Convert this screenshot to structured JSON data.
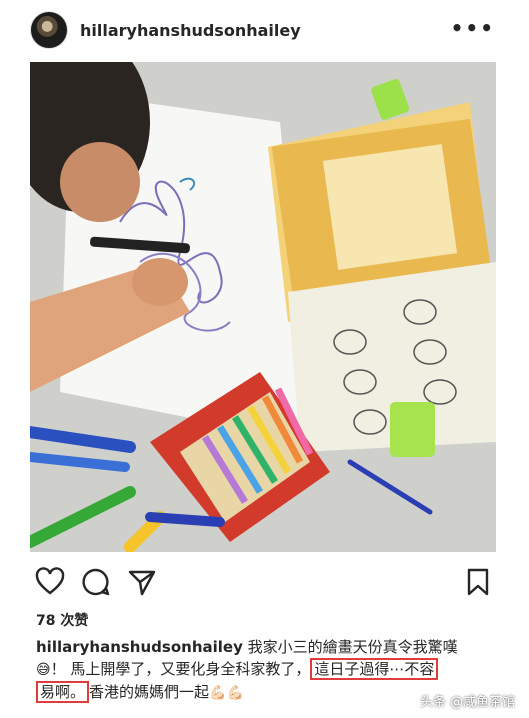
{
  "post": {
    "username": "hillaryhanshudsonhailey",
    "more_label": "•••"
  },
  "icons": {
    "avatar": "profile-avatar",
    "more": "more-options-icon",
    "like": "heart-icon",
    "comment": "comment-icon",
    "share": "send-icon",
    "save": "bookmark-icon",
    "highlight_color": "#e23b3b"
  },
  "likes": {
    "label": "78 次赞"
  },
  "caption": {
    "username": "hillaryhanshudsonhailey",
    "text_part1": " 我家小三的繪畫天份真令我驚嘆",
    "emoji1": "😅",
    "text_part2": "！ 馬上開學了，又要化身全科家教了，",
    "highlight1": "這日子過得⋯不容",
    "highlight2": "易啊。",
    "text_part3": "香港的媽媽們一起",
    "emoji2": "💪🏻💪🏻"
  },
  "watermark": {
    "text": "头条 @咸鱼茶馆"
  }
}
